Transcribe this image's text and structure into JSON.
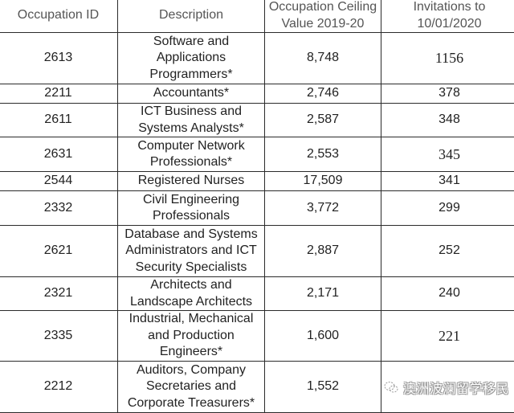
{
  "table": {
    "headers": [
      "Occupation ID",
      "Description",
      "Occupation Ceiling Value 2019-20",
      "Invitations to 10/01/2020"
    ],
    "rows": [
      {
        "id": "2613",
        "description": "Software and Applications Programmers*",
        "ceiling": "8,748",
        "invitations": "1156"
      },
      {
        "id": "2211",
        "description": "Accountants*",
        "ceiling": "2,746",
        "invitations": "378"
      },
      {
        "id": "2611",
        "description": "ICT Business and Systems Analysts*",
        "ceiling": "2,587",
        "invitations": "348"
      },
      {
        "id": "2631",
        "description": "Computer Network Professionals*",
        "ceiling": "2,553",
        "invitations": "345"
      },
      {
        "id": "2544",
        "description": "Registered Nurses",
        "ceiling": "17,509",
        "invitations": "341"
      },
      {
        "id": "2332",
        "description": "Civil Engineering Professionals",
        "ceiling": "3,772",
        "invitations": "299"
      },
      {
        "id": "2621",
        "description": "Database and Systems Administrators and ICT Security Specialists",
        "ceiling": "2,887",
        "invitations": "252"
      },
      {
        "id": "2321",
        "description": "Architects and Landscape Architects",
        "ceiling": "2,171",
        "invitations": "240"
      },
      {
        "id": "2335",
        "description": "Industrial, Mechanical and Production Engineers*",
        "ceiling": "1,600",
        "invitations": "221"
      },
      {
        "id": "2212",
        "description": "Auditors, Company Secretaries and Corporate Treasurers*",
        "ceiling": "1,552",
        "invitations": ""
      }
    ]
  },
  "watermark": {
    "icon": "wechat-icon",
    "text": "澳洲波澜留学移民"
  }
}
